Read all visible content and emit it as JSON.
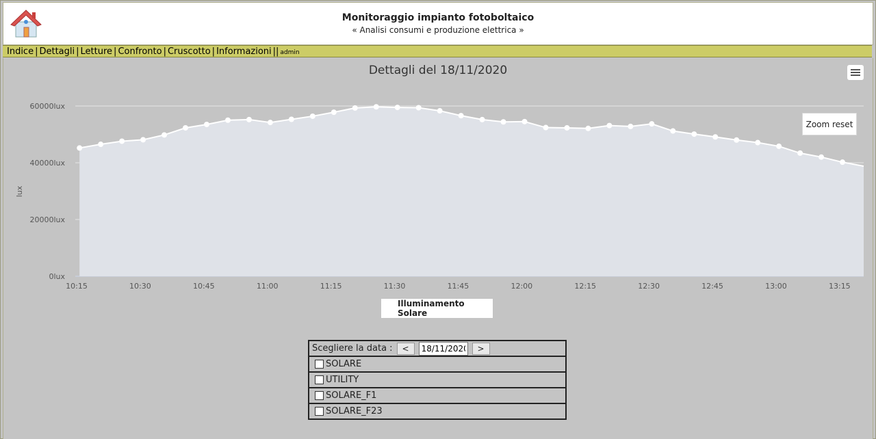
{
  "header": {
    "title": "Monitoraggio impianto fotoboltaico",
    "subtitle": "« Analisi consumi e produzione elettrica »"
  },
  "nav": {
    "items": [
      "Indice",
      "Dettagli",
      "Letture",
      "Confronto",
      "Cruscotto",
      "Informazioni"
    ],
    "separator": "|",
    "double_separator": "||",
    "user": "admin"
  },
  "chart": {
    "zoom_reset_label": "Zoom reset",
    "menu_icon": "hamburger-menu-icon"
  },
  "chart_data": {
    "type": "area",
    "title": "Dettagli del 18/11/2020",
    "ylabel": "lux",
    "xlabel": "",
    "ylim": [
      0,
      60000
    ],
    "y_ticks": [
      "0lux",
      "20000lux",
      "40000lux",
      "60000lux"
    ],
    "y_tick_values": [
      0,
      20000,
      40000,
      60000
    ],
    "x_ticks": [
      "10:15",
      "10:30",
      "10:45",
      "11:00",
      "11:15",
      "11:30",
      "11:45",
      "12:00",
      "12:15",
      "12:30",
      "12:45",
      "13:00",
      "13:15"
    ],
    "x_range_minutes": [
      615,
      801
    ],
    "grid": true,
    "legend_position": "bottom-center",
    "series": [
      {
        "name": "Illuminamento Solare",
        "color": "#ffffff",
        "fill": "#dfe2e8",
        "points": [
          [
            616,
            45200
          ],
          [
            621,
            46500
          ],
          [
            626,
            47600
          ],
          [
            631,
            48100
          ],
          [
            636,
            49800
          ],
          [
            641,
            52300
          ],
          [
            646,
            53500
          ],
          [
            651,
            55000
          ],
          [
            656,
            55200
          ],
          [
            661,
            54200
          ],
          [
            666,
            55300
          ],
          [
            671,
            56400
          ],
          [
            676,
            57800
          ],
          [
            681,
            59300
          ],
          [
            686,
            59700
          ],
          [
            691,
            59500
          ],
          [
            696,
            59400
          ],
          [
            701,
            58300
          ],
          [
            706,
            56600
          ],
          [
            711,
            55200
          ],
          [
            716,
            54400
          ],
          [
            721,
            54500
          ],
          [
            726,
            52400
          ],
          [
            731,
            52300
          ],
          [
            736,
            52100
          ],
          [
            741,
            53100
          ],
          [
            746,
            52800
          ],
          [
            751,
            53700
          ],
          [
            756,
            51200
          ],
          [
            761,
            50100
          ],
          [
            766,
            49100
          ],
          [
            771,
            48000
          ],
          [
            776,
            47100
          ],
          [
            781,
            45800
          ],
          [
            786,
            43400
          ],
          [
            791,
            42000
          ],
          [
            796,
            40200
          ],
          [
            801,
            38800
          ]
        ]
      }
    ]
  },
  "form": {
    "date_label": "Scegliere la data :",
    "prev_label": "<",
    "next_label": ">",
    "date_value": "18/11/2020",
    "options": [
      "SOLARE",
      "UTILITY",
      "SOLARE_F1",
      "SOLARE_F23"
    ]
  }
}
